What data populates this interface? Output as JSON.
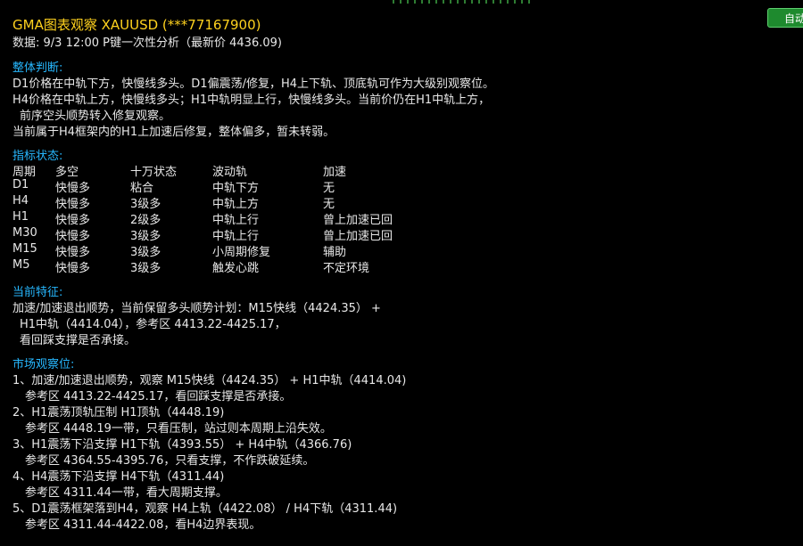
{
  "window": {
    "title": "GMA图表观察 XAUUSD (***77167900)",
    "subtitle": "数据: 9/3 12:00   P键一次性分析（最新价 4436.09)",
    "auto_button": "自动"
  },
  "overall": {
    "heading": "整体判断:",
    "lines": [
      "D1价格在中轨下方，快慢线多头。D1偏震荡/修复，H4上下轨、顶底轨可作为大级别观察位。",
      "H4价格在中轨上方，快慢线多头；H1中轨明显上行，快慢线多头。当前价仍在H1中轨上方，",
      "前序空头顺势转入修复观察。",
      "当前属于H4框架内的H1上加速后修复，整体偏多，暂未转弱。"
    ]
  },
  "indicators": {
    "heading": "指标状态:",
    "columns": [
      "周期",
      "多空",
      "十万状态",
      "波动轨",
      "加速"
    ],
    "rows": [
      [
        "D1",
        "快慢多",
        "粘合",
        "中轨下方",
        "无"
      ],
      [
        "H4",
        "快慢多",
        "3级多",
        "中轨上方",
        "无"
      ],
      [
        "H1",
        "快慢多",
        "2级多",
        "中轨上行",
        "曾上加速已回"
      ],
      [
        "M30",
        "快慢多",
        "3级多",
        "中轨上行",
        "曾上加速已回"
      ],
      [
        "M15",
        "快慢多",
        "3级多",
        "小周期修复",
        "辅助"
      ],
      [
        "M5",
        "快慢多",
        "3级多",
        "触发心跳",
        "不定环境"
      ]
    ]
  },
  "current": {
    "heading": "当前特征:",
    "lines": [
      "加速/加速退出顺势，当前保留多头顺势计划：M15快线（4424.35）  +",
      "H1中轨（4414.04），参考区 4413.22-4425.17，",
      "看回踩支撑是否承接。"
    ]
  },
  "market": {
    "heading": "市场观察位:",
    "lines": [
      "1、加速/加速退出顺势，观察 M15快线（4424.35） + H1中轨（4414.04)",
      "参考区 4413.22-4425.17，看回踩支撑是否承接。",
      "2、H1震荡顶轨压制 H1顶轨（4448.19)",
      "参考区 4448.19一带，只看压制，站过则本周期上沿失效。",
      "3、H1震荡下沿支撑 H1下轨（4393.55） + H4中轨（4366.76)",
      "参考区 4364.55-4395.76，只看支撑，不作跌破延续。",
      "4、H4震荡下沿支撑 H4下轨（4311.44)",
      "参考区 4311.44一带，看大周期支撑。",
      "5、D1震荡框架落到H4，观察 H4上轨（4422.08） / H4下轨（4311.44)",
      "参考区 4311.44-4422.08，看H4边界表现。"
    ]
  }
}
